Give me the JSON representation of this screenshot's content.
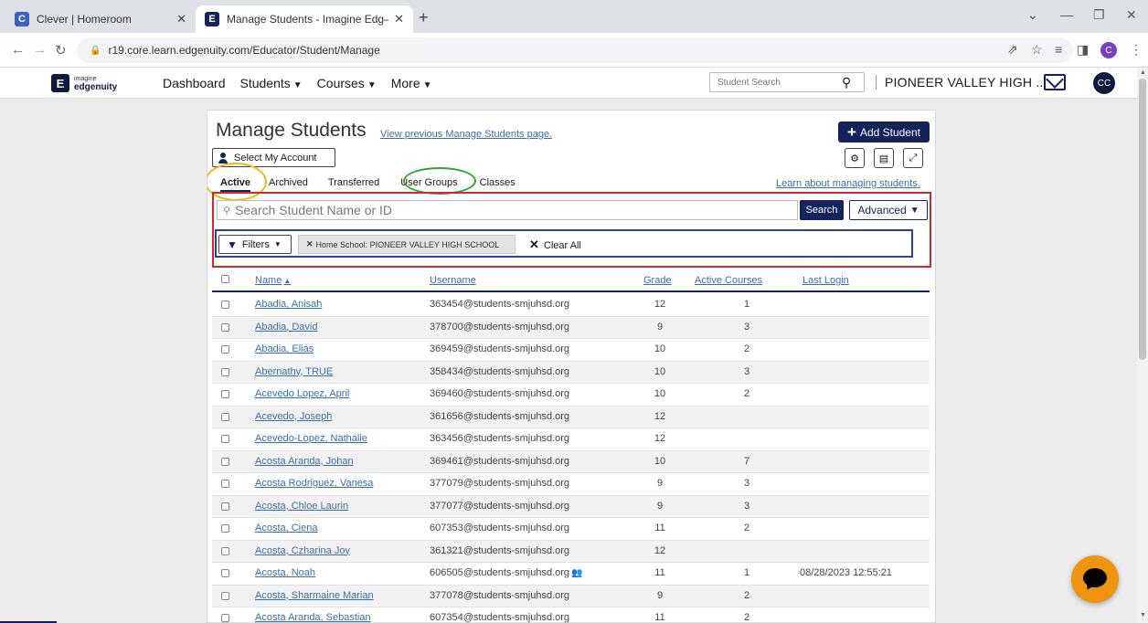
{
  "browser": {
    "tabs": [
      {
        "title": "Clever | Homeroom",
        "favicon": "C",
        "favicon_color": "#3a61c8"
      },
      {
        "title": "Manage Students - Imagine Edg—",
        "favicon": "E",
        "favicon_color": "#14235c"
      }
    ],
    "url": "r19.core.learn.edgenuity.com/Educator/Student/Manage",
    "profile_initial": "C"
  },
  "header": {
    "logo_small": "imagine",
    "logo_big": "edgenuity",
    "nav": [
      "Dashboard",
      "Students",
      "Courses",
      "More"
    ],
    "student_search_placeholder": "Student Search",
    "school": "PIONEER VALLEY HIGH ...",
    "avatar_initials": "CC"
  },
  "page": {
    "title": "Manage Students",
    "prev_link": "View previous Manage Students page.",
    "add_student": "Add Student",
    "select_account": "Select My Account",
    "tabs": [
      "Active",
      "Archived",
      "Transferred",
      "User Groups",
      "Classes"
    ],
    "learn_link": "Learn about managing students.",
    "search_placeholder": "Search Student Name or ID",
    "search_button": "Search",
    "advanced_button": "Advanced",
    "filters_button": "Filters",
    "filter_chip": "Home School: PIONEER VALLEY HIGH SCHOOL",
    "clear_all": "Clear All"
  },
  "table": {
    "columns": [
      "Name",
      "Username",
      "Grade",
      "Active Courses",
      "Last Login"
    ],
    "rows": [
      {
        "name": "Abadia, Anisah",
        "username": "363454@students-smjuhsd.org",
        "grade": "12",
        "courses": "1",
        "last_login": ""
      },
      {
        "name": "Abadia, David",
        "username": "378700@students-smjuhsd.org",
        "grade": "9",
        "courses": "3",
        "last_login": ""
      },
      {
        "name": "Abadia, Elias",
        "username": "369459@students-smjuhsd.org",
        "grade": "10",
        "courses": "2",
        "last_login": ""
      },
      {
        "name": "Abernathy, TRUE",
        "username": "358434@students-smjuhsd.org",
        "grade": "10",
        "courses": "3",
        "last_login": ""
      },
      {
        "name": "Acevedo Lopez, April",
        "username": "369460@students-smjuhsd.org",
        "grade": "10",
        "courses": "2",
        "last_login": ""
      },
      {
        "name": "Acevedo, Joseph",
        "username": "361656@students-smjuhsd.org",
        "grade": "12",
        "courses": "",
        "last_login": ""
      },
      {
        "name": "Acevedo-Lopez, Nathalie",
        "username": "363456@students-smjuhsd.org",
        "grade": "12",
        "courses": "",
        "last_login": ""
      },
      {
        "name": "Acosta Aranda, Johan",
        "username": "369461@students-smjuhsd.org",
        "grade": "10",
        "courses": "7",
        "last_login": ""
      },
      {
        "name": "Acosta Rodriguez, Vanesa",
        "username": "377079@students-smjuhsd.org",
        "grade": "9",
        "courses": "3",
        "last_login": ""
      },
      {
        "name": "Acosta, Chloe Laurin",
        "username": "377077@students-smjuhsd.org",
        "grade": "9",
        "courses": "3",
        "last_login": ""
      },
      {
        "name": "Acosta, Ciena",
        "username": "607353@students-smjuhsd.org",
        "grade": "11",
        "courses": "2",
        "last_login": ""
      },
      {
        "name": "Acosta, Czharina Joy",
        "username": "361321@students-smjuhsd.org",
        "grade": "12",
        "courses": "",
        "last_login": ""
      },
      {
        "name": "Acosta, Noah",
        "username": "606505@students-smjuhsd.org",
        "grade": "11",
        "courses": "1",
        "last_login": "08/28/2023 12:55:21",
        "group_icon": true
      },
      {
        "name": "Acosta, Sharmaine Marian",
        "username": "377078@students-smjuhsd.org",
        "grade": "9",
        "courses": "2",
        "last_login": ""
      },
      {
        "name": "Acosta Aranda, Sebastian",
        "username": "607354@students-smjuhsd.org",
        "grade": "11",
        "courses": "2",
        "last_login": ""
      }
    ]
  },
  "colors": {
    "navy": "#14235c",
    "link": "#3b6ea8",
    "highlight_orange": "#f2b619",
    "highlight_green": "#31a634",
    "highlight_red": "#d62828",
    "highlight_blue": "#2e3bb4",
    "chat": "#f0930f"
  }
}
